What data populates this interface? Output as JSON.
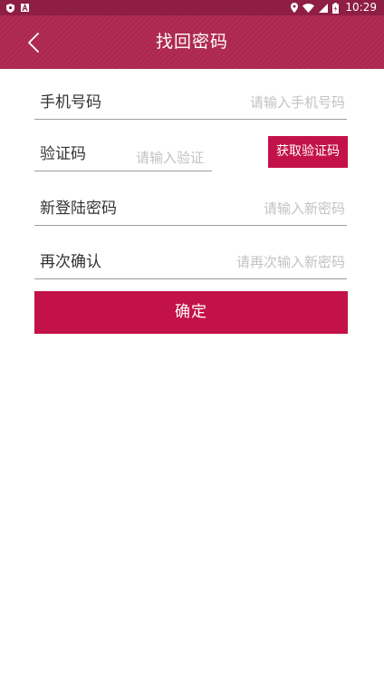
{
  "status_bar": {
    "time": "10:29",
    "left_icons": [
      "shield-icon",
      "font-a-icon"
    ],
    "right_icons": [
      "location-pin-icon",
      "wifi-icon",
      "signal-icon",
      "battery-icon"
    ]
  },
  "app_bar": {
    "title": "找回密码",
    "back_icon": "chevron-left-icon",
    "background_color": "#ad2650"
  },
  "form": {
    "phone": {
      "label": "手机号码",
      "placeholder": "请输入手机号码",
      "value": ""
    },
    "code": {
      "label": "验证码",
      "placeholder": "请输入验证",
      "value": "",
      "get_code_label": "获取验证码"
    },
    "new_password": {
      "label": "新登陆密码",
      "placeholder": "请输入新密码",
      "value": ""
    },
    "confirm_password": {
      "label": "再次确认",
      "placeholder": "请再次输入新密码",
      "value": ""
    },
    "submit_label": "确定"
  },
  "colors": {
    "status_bar": "#8e1e44",
    "accent": "#c3124a",
    "divider": "#9e9e9e",
    "placeholder": "#c2c2c2"
  }
}
